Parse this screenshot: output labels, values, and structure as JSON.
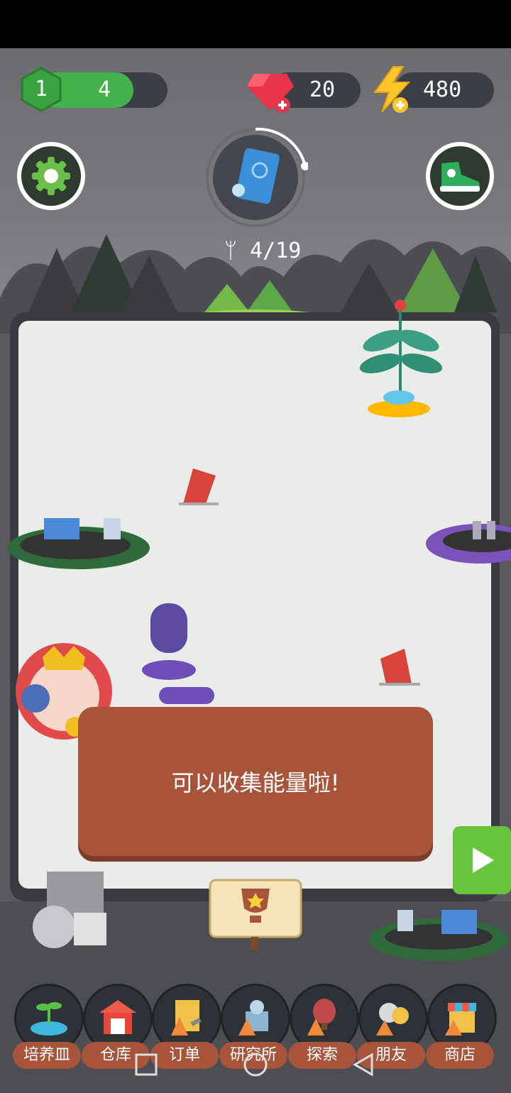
{
  "hud": {
    "level": "1",
    "level_progress": "4",
    "gems": "20",
    "energy": "480"
  },
  "collection": {
    "count": "4/19"
  },
  "dialog": {
    "text": "可以收集能量啦!"
  },
  "nav": {
    "items": [
      {
        "label": "培养皿",
        "icon": "petri-dish-icon"
      },
      {
        "label": "仓库",
        "icon": "warehouse-icon"
      },
      {
        "label": "订单",
        "icon": "orders-icon"
      },
      {
        "label": "研究所",
        "icon": "research-institute-icon"
      },
      {
        "label": "探索",
        "icon": "explore-icon"
      },
      {
        "label": "朋友",
        "icon": "friends-icon"
      },
      {
        "label": "商店",
        "icon": "shop-icon"
      }
    ]
  },
  "colors": {
    "level_green": "#44b24a",
    "pill_bg": "#3b3e44",
    "dialog_brown": "#a8543b",
    "play_green": "#68c53b"
  }
}
